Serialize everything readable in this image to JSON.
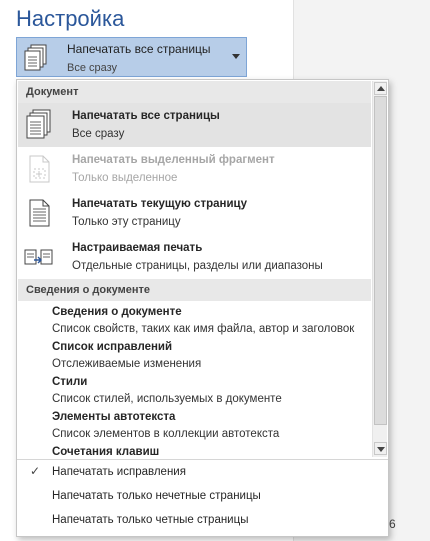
{
  "section": {
    "title": "Настройка"
  },
  "dropdown": {
    "title": "Напечатать все страницы",
    "subtitle": "Все сразу"
  },
  "menu": {
    "groups": [
      {
        "header": "Документ",
        "items": [
          {
            "title": "Напечатать все страницы",
            "subtitle": "Все сразу",
            "icon": "print-all-pages-icon",
            "selected": true,
            "disabled": false
          },
          {
            "title": "Напечатать выделенный фрагмент",
            "subtitle": "Только выделенное",
            "icon": "print-selection-icon",
            "selected": false,
            "disabled": true
          },
          {
            "title": "Напечатать текущую страницу",
            "subtitle": "Только эту страницу",
            "icon": "print-current-page-icon",
            "selected": false,
            "disabled": false
          },
          {
            "title": "Настраиваемая печать",
            "subtitle": "Отдельные страницы, разделы или диапазоны",
            "icon": "custom-print-icon",
            "selected": false,
            "disabled": false
          }
        ]
      },
      {
        "header": "Сведения о документе",
        "items": [
          {
            "title": "Сведения о документе",
            "subtitle": "Список свойств, таких как имя файла, автор и заголовок"
          },
          {
            "title": "Список исправлений",
            "subtitle": "Отслеживаемые изменения"
          },
          {
            "title": "Стили",
            "subtitle": "Список стилей, используемых в документе"
          },
          {
            "title": "Элементы автотекста",
            "subtitle": "Список элементов в коллекции автотекста"
          },
          {
            "title": "Сочетания клавиш",
            "subtitle": ""
          }
        ]
      }
    ],
    "options": [
      {
        "label": "Напечатать исправления",
        "checked": true
      },
      {
        "label": "Напечатать только нечетные страницы",
        "checked": false
      },
      {
        "label": "Напечатать только четные страницы",
        "checked": false
      }
    ]
  },
  "page_number": "6",
  "colors": {
    "accent": "#2b579a",
    "dropdown_bg": "#b7cde8",
    "selected_bg": "#e3e3e3"
  }
}
